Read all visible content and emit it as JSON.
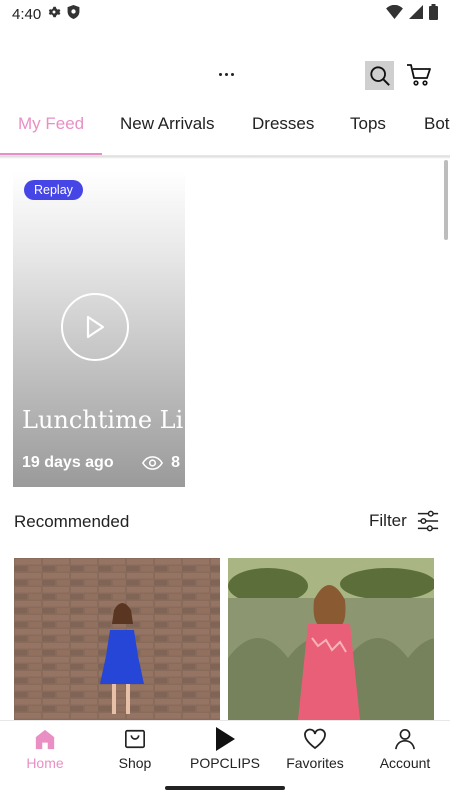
{
  "status_bar": {
    "time": "4:40",
    "left_icons": [
      "gear-icon",
      "shield-icon"
    ],
    "right_icons": [
      "wifi-icon",
      "signal-icon",
      "battery-icon"
    ]
  },
  "app_bar": {
    "icons": [
      "more-dots-icon",
      "search-icon",
      "cart-icon"
    ]
  },
  "tabs": [
    {
      "label": "My Feed",
      "active": true
    },
    {
      "label": "New Arrivals",
      "active": false
    },
    {
      "label": "Dresses",
      "active": false
    },
    {
      "label": "Tops",
      "active": false
    },
    {
      "label": "Bot",
      "active": false
    }
  ],
  "live_card": {
    "badge": "Replay",
    "title": "Lunchtime Li...",
    "age": "19 days ago",
    "views": "8"
  },
  "recommended": {
    "title": "Recommended",
    "filter_label": "Filter",
    "products": [
      {
        "image": "blue-dress-photo"
      },
      {
        "image": "pink-dress-photo"
      }
    ]
  },
  "bottom_nav": [
    {
      "label": "Home",
      "icon": "home-icon",
      "active": true
    },
    {
      "label": "Shop",
      "icon": "shopping-bag-icon",
      "active": false
    },
    {
      "label": "POPCLIPS",
      "icon": "play-icon",
      "active": false
    },
    {
      "label": "Favorites",
      "icon": "heart-icon",
      "active": false
    },
    {
      "label": "Account",
      "icon": "person-icon",
      "active": false
    }
  ],
  "colors": {
    "accent": "#e98fc4",
    "replay_badge": "#4646e6",
    "text": "#222222"
  }
}
